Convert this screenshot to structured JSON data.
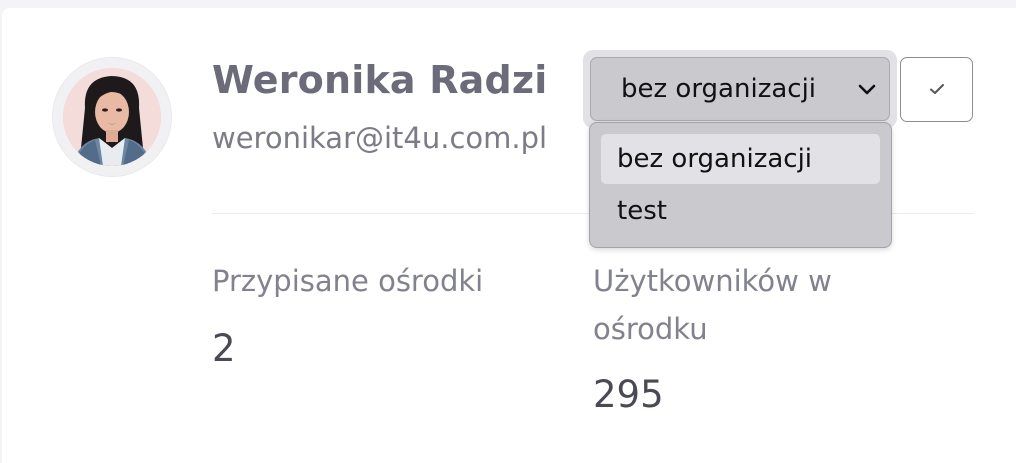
{
  "user": {
    "name": "Weronika Radzi",
    "email": "weronikar@it4u.com.pl",
    "avatar_icon": "user-photo-icon"
  },
  "organization_select": {
    "selected": "bez organizacji",
    "options": [
      "bez organizacji",
      "test"
    ],
    "highlighted_index": 0,
    "icon": "chevron-down-icon"
  },
  "confirm_button": {
    "icon": "check-icon"
  },
  "stats": {
    "assigned_centers": {
      "label": "Przypisane ośrodki",
      "value": "2"
    },
    "users_in_center": {
      "label_line1": "Użytkowników w",
      "label_line2": "ośrodku",
      "value": "295"
    }
  },
  "colors": {
    "name_text": "#6b6b7a",
    "select_bg": "#cacace",
    "option_highlight": "#e2e2e6",
    "value_text": "#4a4a55"
  }
}
